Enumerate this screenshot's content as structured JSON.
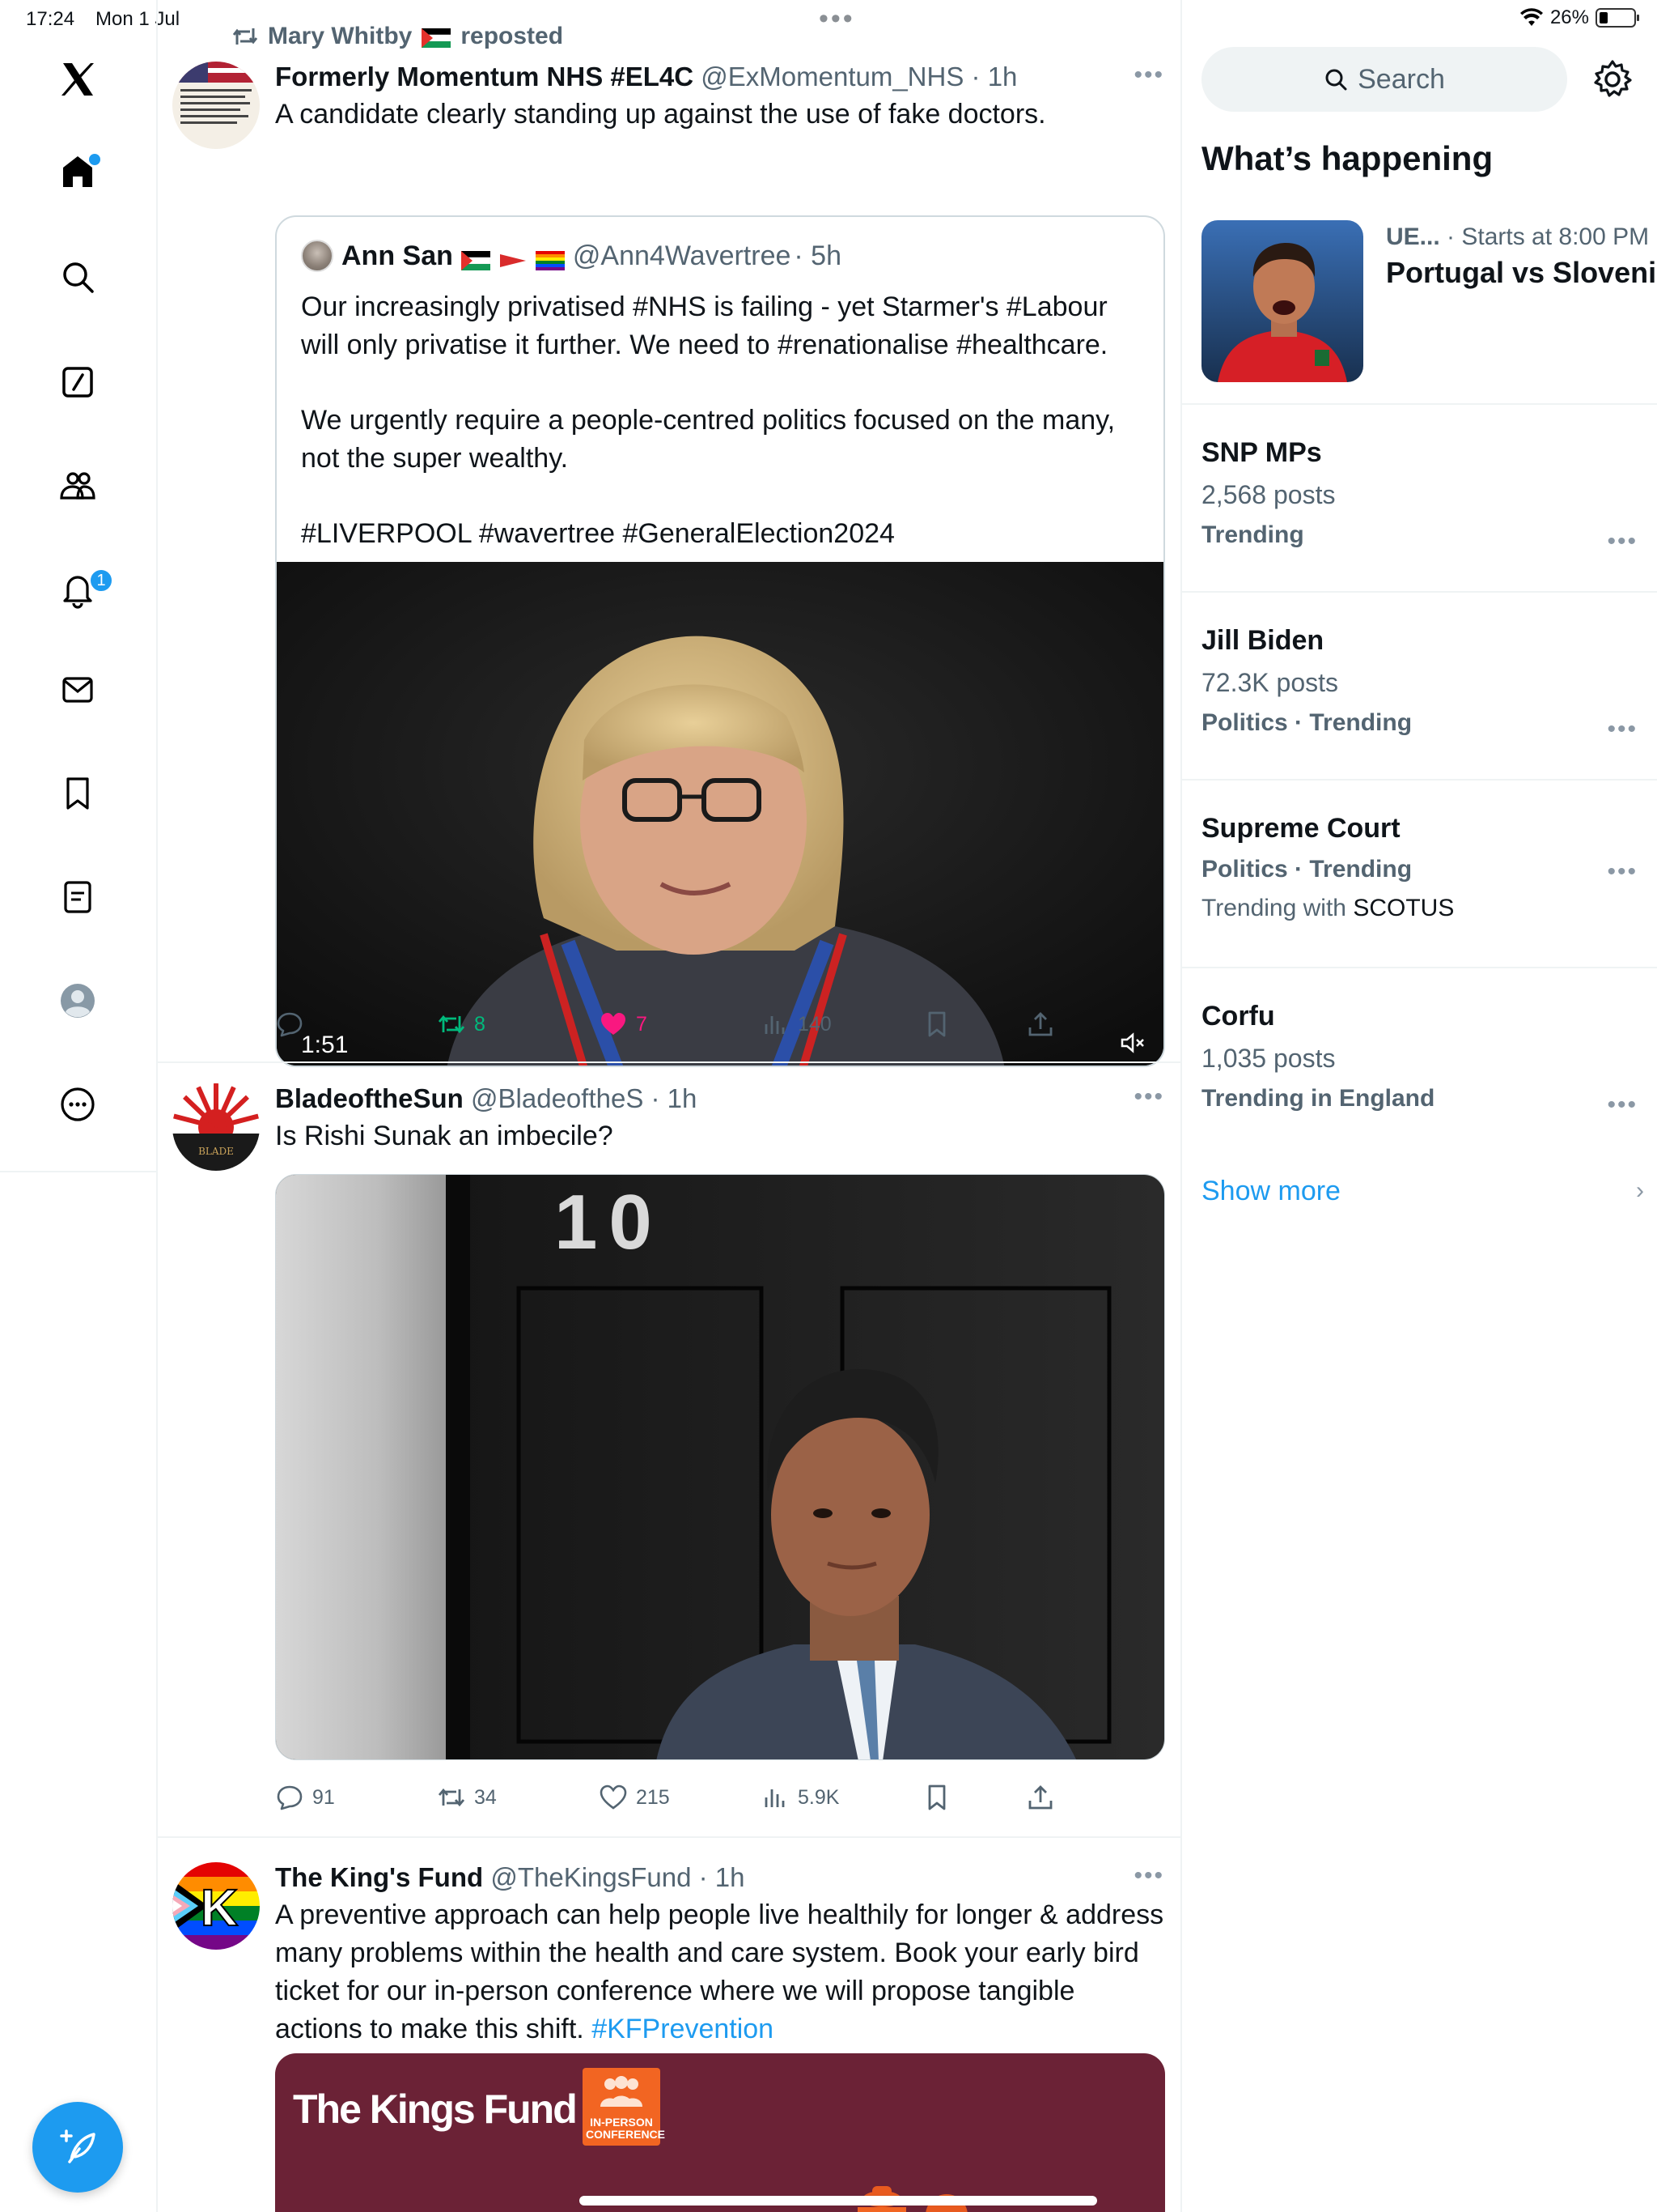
{
  "status": {
    "time": "17:24",
    "date": "Mon 1 Jul",
    "battery": "26%"
  },
  "nav": {
    "notifications_count": "1"
  },
  "feed": {
    "tweet1": {
      "repost_by": "Mary Whitby",
      "repost_label": "reposted",
      "name": "Formerly Momentum NHS #EL4C",
      "handle": "@ExMomentum_NHS",
      "time": "· 1h",
      "text": "A candidate clearly standing up against the use of fake doctors.",
      "quote": {
        "name": "Ann San",
        "handle": "@Ann4Wavertree",
        "time": "· 5h",
        "paragraph1": "Our increasingly privatised #NHS is failing - yet Starmer's #Labour will only privatise it further. We need to #renationalise #healthcare.",
        "paragraph2": "We urgently require a people-centred politics focused on the many, not the super wealthy.",
        "paragraph3": "#LIVERPOOL #wavertree #GeneralElection2024",
        "video_duration": "1:51"
      },
      "reposts": "8",
      "likes": "7",
      "views": "140"
    },
    "tweet2": {
      "name": "BladeoftheSun",
      "handle": "@BladeoftheS",
      "time": "· 1h",
      "text": "Is Rishi Sunak an imbecile?",
      "image_door_number": "10",
      "replies": "91",
      "reposts": "34",
      "likes": "215",
      "views": "5.9K"
    },
    "tweet3": {
      "name": "The King's Fund",
      "handle": "@TheKingsFund",
      "time": "· 1h",
      "text_plain": "A preventive approach can help people live healthily for longer & address many problems within the health and care system. Book your early bird ticket for our in-person conference where we will propose tangible actions to make this shift.",
      "text_hashtag": "#KFPrevention",
      "card_brand": "The Kings Fund",
      "card_badge": "IN-PERSON CONFERENCE"
    }
  },
  "sidebar": {
    "search_placeholder": "Search",
    "whats_happening": "What’s happening",
    "event": {
      "league": "UE...",
      "starts": "· Starts at 8:00 PM",
      "title": "Portugal vs Slovenia"
    },
    "trends": [
      {
        "topic": "SNP MPs",
        "count": "2,568 posts",
        "meta": "Trending"
      },
      {
        "topic": "Jill Biden",
        "count": "72.3K posts",
        "meta": "Politics · Trending"
      },
      {
        "topic": "Supreme Court",
        "meta": "Politics · Trending",
        "with_label": "Trending with",
        "with_value": "SCOTUS"
      },
      {
        "topic": "Corfu",
        "count": "1,035 posts",
        "meta": "Trending in England"
      }
    ],
    "show_more": "Show more"
  },
  "colors": {
    "accent": "#1d9bf0",
    "like": "#f91880",
    "repost": "#00ba7c",
    "kf_card": "#6b2236"
  }
}
